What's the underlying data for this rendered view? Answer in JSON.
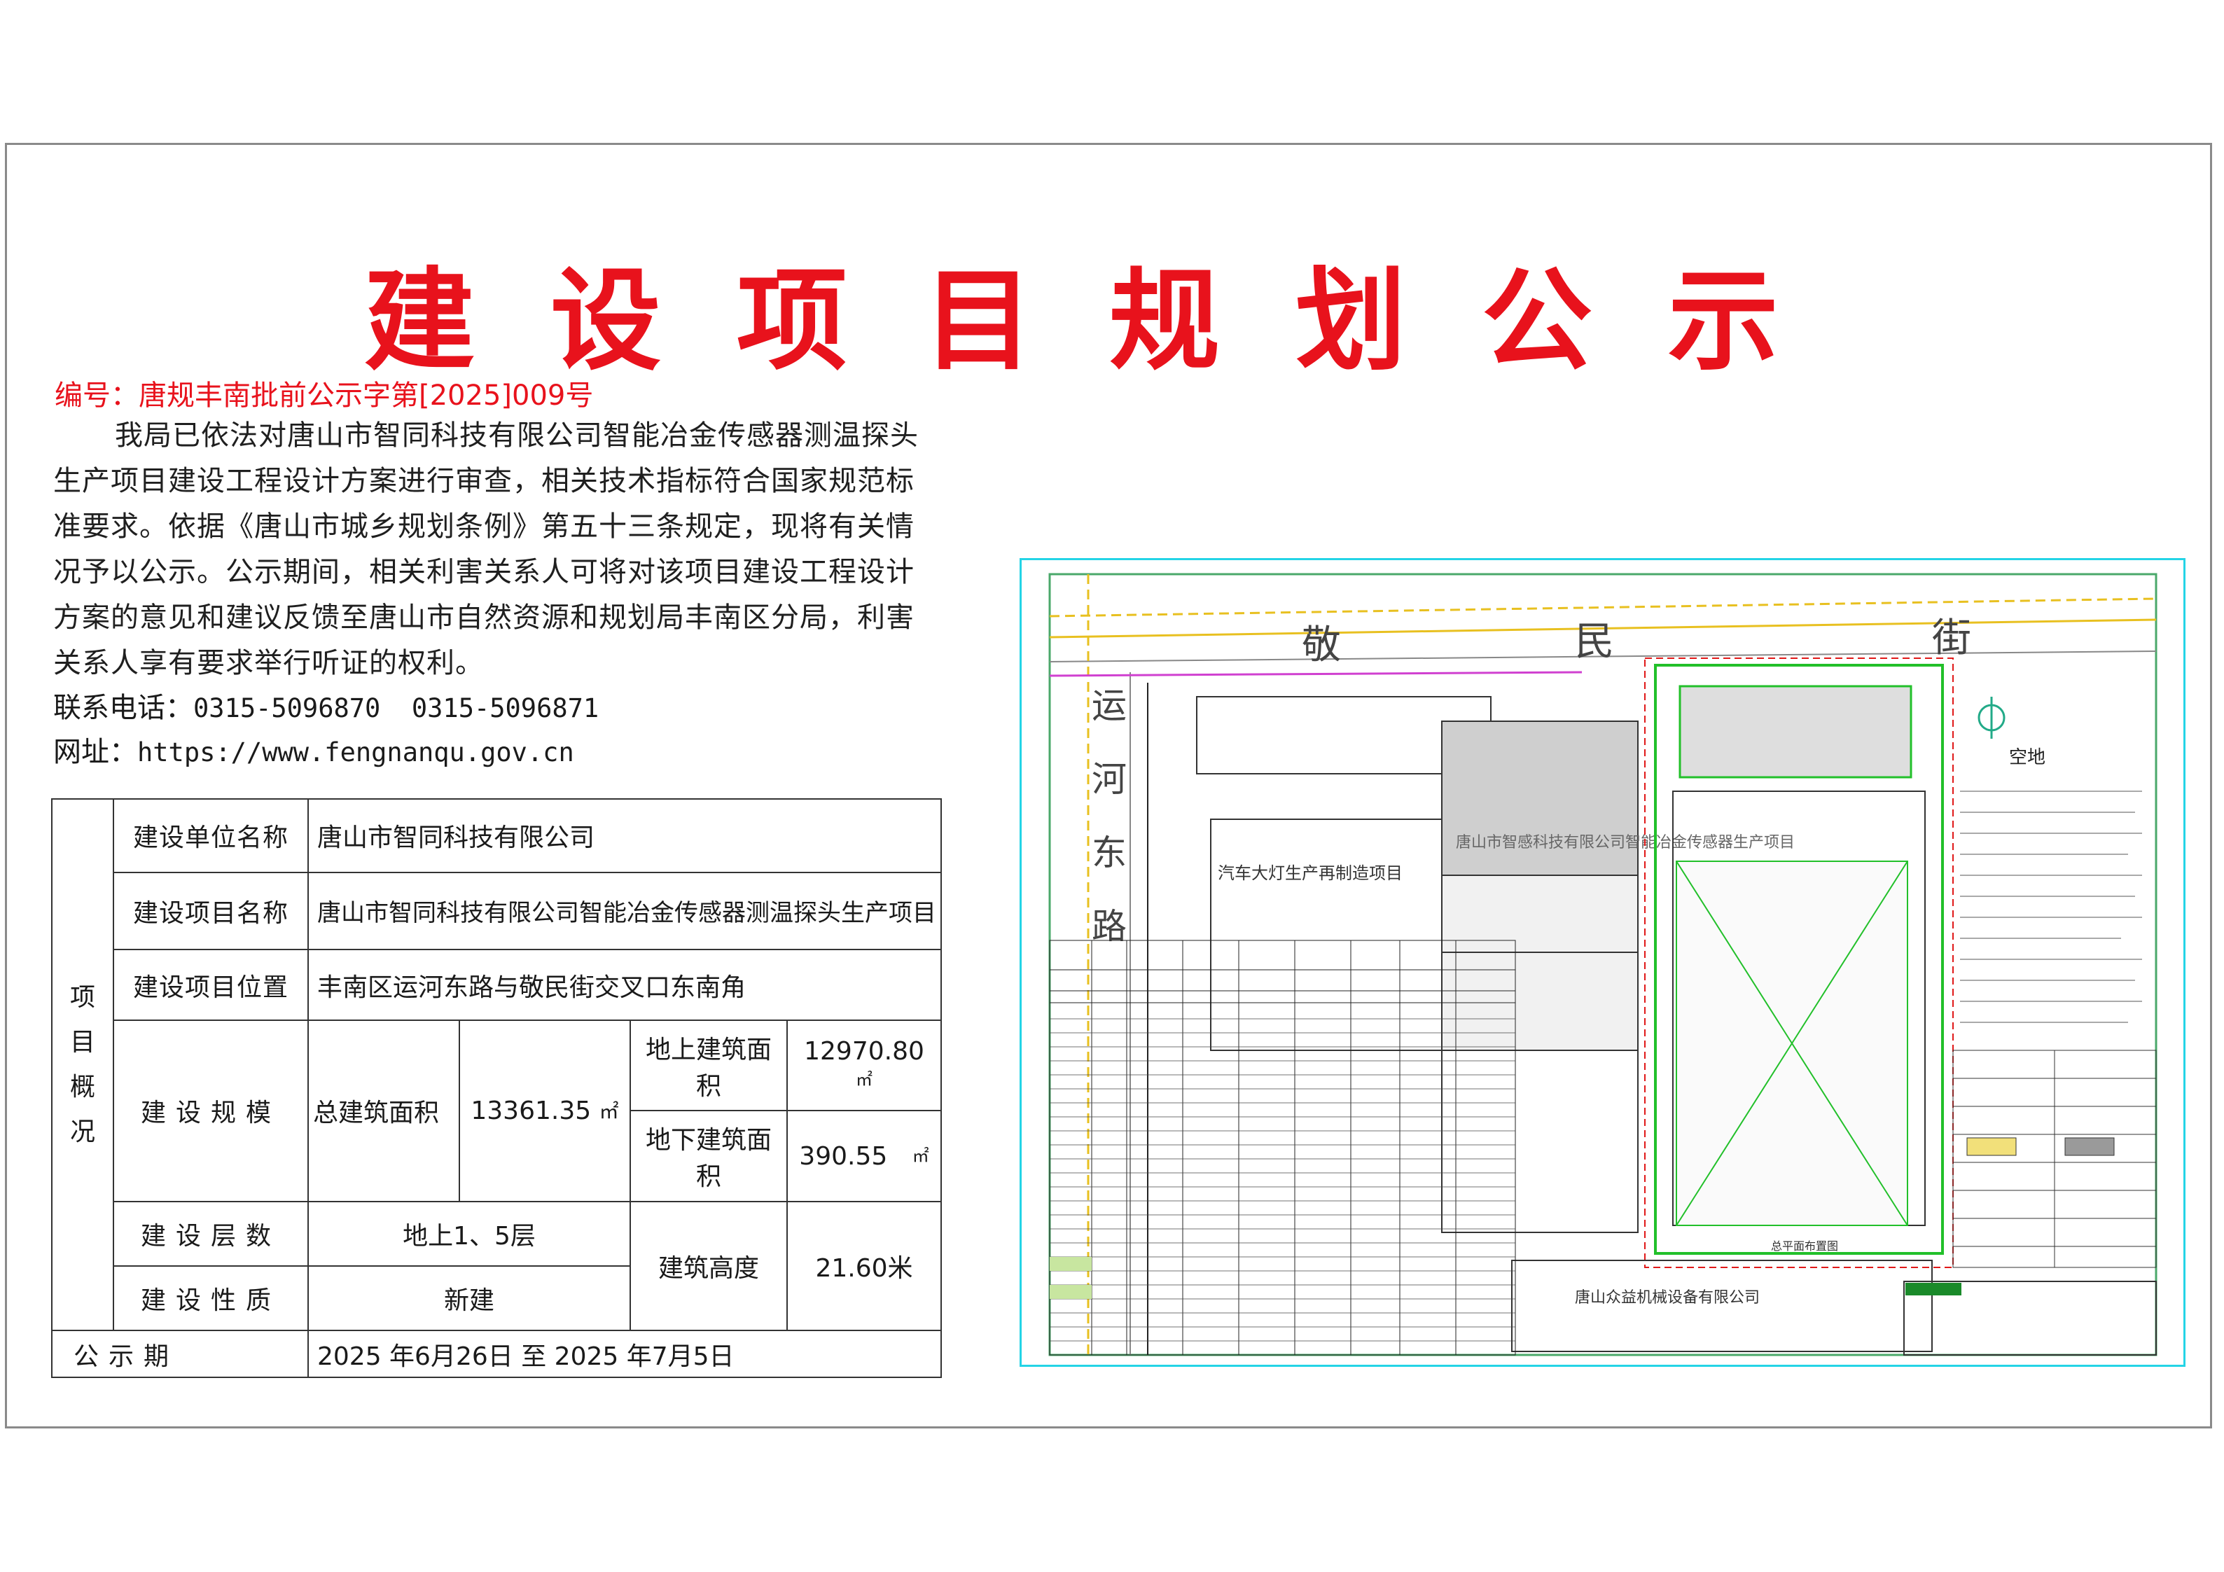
{
  "title": "建设项目规划公示",
  "doc_number": "编号：唐规丰南批前公示字第[2025]009号",
  "notice_text": "我局已依法对唐山市智同科技有限公司智能冶金传感器测温探头生产项目建设工程设计方案进行审查，相关技术指标符合国家规范标准要求。依据《唐山市城乡规划条例》第五十三条规定，现将有关情况予以公示。公示期间，相关利害关系人可将对该项目建设工程设计方案的意见和建议反馈至唐山市自然资源和规划局丰南区分局，利害关系人享有要求举行听证的权利。",
  "contact": {
    "phone_label": "联系电话：",
    "phone_value": "0315-5096870  0315-5096871",
    "web_label": "网址：",
    "web_value": "https://www.fengnanqu.gov.cn"
  },
  "overview": {
    "side_label": "项目概况",
    "unit_label": "建设单位名称",
    "unit_value": "唐山市智同科技有限公司",
    "project_label": "建设项目名称",
    "project_value": "唐山市智同科技有限公司智能冶金传感器测温探头生产项目",
    "location_label": "建设项目位置",
    "location_value": "丰南区运河东路与敬民街交叉口东南角",
    "scale_label": "建设规模",
    "total_area_label": "总建筑面积",
    "total_area_value": "13361.35",
    "area_unit": "㎡",
    "above_label": "地上建筑面积",
    "above_value": "12970.80",
    "below_label": "地下建筑面积",
    "below_value": "390.55",
    "floors_label": "建设层数",
    "floors_value": "地上1、5层",
    "height_label": "建筑高度",
    "height_value": "21.60米",
    "nature_label": "建设性质",
    "nature_value": "新建",
    "period_label": "公示期",
    "period_value": "2025 年6月26日 至 2025 年7月5日"
  },
  "drawing": {
    "road_north": "敬民街",
    "road_west": "运河东路",
    "site_label": "唐山市智感科技有限公司智能冶金传感器生产项目",
    "neighbor_west": "汽车大灯生产再制造项目",
    "neighbor_south": "唐山众益机械设备有限公司",
    "empty_land": "空地",
    "plan_title": "总平面布置图",
    "colors": {
      "frame": "#24d4e6",
      "title_red": "#e8121c",
      "site_green": "#22c02a",
      "road_yellow": "#e8c020"
    }
  }
}
